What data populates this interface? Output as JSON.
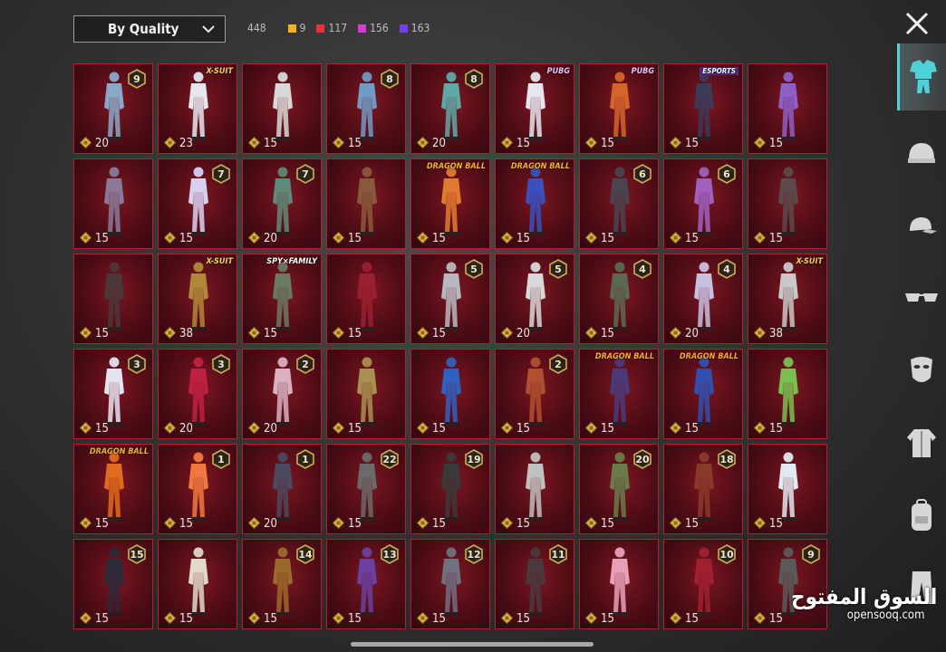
{
  "header": {
    "sort_label": "By Quality",
    "total_count": "448",
    "tiers": [
      {
        "value": "9",
        "color": "#f4b223"
      },
      {
        "value": "117",
        "color": "#e8303a"
      },
      {
        "value": "156",
        "color": "#d93bd0"
      },
      {
        "value": "163",
        "color": "#7a3cf0"
      }
    ]
  },
  "items": [
    {
      "badge": "9",
      "count": "20",
      "color": "#8aa8c8"
    },
    {
      "badge": "X-SUIT",
      "count": "23",
      "color": "#e4e6f0"
    },
    {
      "badge": "",
      "count": "15",
      "color": "#d8d8d8"
    },
    {
      "badge": "8",
      "count": "15",
      "color": "#6f9bc4"
    },
    {
      "badge": "8",
      "count": "20",
      "color": "#5ea8a8"
    },
    {
      "badge": "PUBG",
      "count": "15",
      "color": "#e6e6ee"
    },
    {
      "badge": "PUBG",
      "count": "15",
      "color": "#d2642c"
    },
    {
      "badge": "ESPORTS",
      "count": "15",
      "color": "#3b3a58"
    },
    {
      "badge": "",
      "count": "15",
      "color": "#8c60c8"
    },
    {
      "badge": "",
      "count": "15",
      "color": "#8a7a9a"
    },
    {
      "badge": "7",
      "count": "15",
      "color": "#d8d0f0"
    },
    {
      "badge": "7",
      "count": "20",
      "color": "#5e8a7a"
    },
    {
      "badge": "",
      "count": "15",
      "color": "#8a5a3a"
    },
    {
      "badge": "DRAGON BALL",
      "count": "15",
      "color": "#e07a30"
    },
    {
      "badge": "DRAGON BALL",
      "count": "15",
      "color": "#3850c0"
    },
    {
      "badge": "6",
      "count": "15",
      "color": "#4a4450"
    },
    {
      "badge": "6",
      "count": "15",
      "color": "#a060c0"
    },
    {
      "badge": "",
      "count": "15",
      "color": "#5a4a4a"
    },
    {
      "badge": "",
      "count": "15",
      "color": "#4a3838"
    },
    {
      "badge": "X-SUIT",
      "count": "38",
      "color": "#b0883a"
    },
    {
      "badge": "SPY×FAMILY",
      "count": "15",
      "color": "#6a7a60"
    },
    {
      "badge": "",
      "count": "15",
      "color": "#9a2030"
    },
    {
      "badge": "5",
      "count": "15",
      "color": "#b8b8c0"
    },
    {
      "badge": "5",
      "count": "20",
      "color": "#d8d8d8"
    },
    {
      "badge": "4",
      "count": "15",
      "color": "#5a6a50"
    },
    {
      "badge": "4",
      "count": "20",
      "color": "#c8c0e0"
    },
    {
      "badge": "X-SUIT",
      "count": "38",
      "color": "#c8c8c8"
    },
    {
      "badge": "3",
      "count": "15",
      "color": "#e4e4f0"
    },
    {
      "badge": "3",
      "count": "20",
      "color": "#c02040"
    },
    {
      "badge": "2",
      "count": "20",
      "color": "#d8b0c0"
    },
    {
      "badge": "",
      "count": "15",
      "color": "#a89050"
    },
    {
      "badge": "",
      "count": "15",
      "color": "#3060c0"
    },
    {
      "badge": "2",
      "count": "15",
      "color": "#b05030"
    },
    {
      "badge": "DRAGON BALL",
      "count": "15",
      "color": "#4a3a7a"
    },
    {
      "badge": "DRAGON BALL",
      "count": "15",
      "color": "#3050b0"
    },
    {
      "badge": "",
      "count": "15",
      "color": "#7ac050"
    },
    {
      "badge": "DRAGON BALL",
      "count": "15",
      "color": "#e06a20"
    },
    {
      "badge": "1",
      "count": "15",
      "color": "#f07840"
    },
    {
      "badge": "1",
      "count": "20",
      "color": "#4a4a60"
    },
    {
      "badge": "22",
      "count": "15",
      "color": "#6a6a6a"
    },
    {
      "badge": "19",
      "count": "15",
      "color": "#3a3a3a"
    },
    {
      "badge": "",
      "count": "15",
      "color": "#c0c0c0"
    },
    {
      "badge": "20",
      "count": "15",
      "color": "#6a7a4a"
    },
    {
      "badge": "18",
      "count": "15",
      "color": "#8a3a2a"
    },
    {
      "badge": "",
      "count": "15",
      "color": "#e0e8f0"
    },
    {
      "badge": "15",
      "count": "15",
      "color": "#2a2a3a"
    },
    {
      "badge": "",
      "count": "15",
      "color": "#e0d8c8"
    },
    {
      "badge": "14",
      "count": "15",
      "color": "#9a6a2a"
    },
    {
      "badge": "13",
      "count": "15",
      "color": "#6a40a0"
    },
    {
      "badge": "12",
      "count": "15",
      "color": "#707080"
    },
    {
      "badge": "11",
      "count": "15",
      "color": "#4a3a40"
    },
    {
      "badge": "",
      "count": "15",
      "color": "#e8a0b8"
    },
    {
      "badge": "10",
      "count": "15",
      "color": "#a02030"
    },
    {
      "badge": "9",
      "count": "15",
      "color": "#5a5a5a"
    }
  ],
  "sidebar": [
    {
      "icon": "outfit-icon",
      "active": true
    },
    {
      "icon": "helmet-icon",
      "active": false
    },
    {
      "icon": "cap-icon",
      "active": false
    },
    {
      "icon": "glasses-icon",
      "active": false
    },
    {
      "icon": "mask-icon",
      "active": false
    },
    {
      "icon": "jacket-icon",
      "active": false
    },
    {
      "icon": "backpack-icon",
      "active": false
    },
    {
      "icon": "pants-icon",
      "active": false
    }
  ],
  "watermark": {
    "arabic": "السوق المفتوح",
    "latin": "opensooq.com"
  }
}
